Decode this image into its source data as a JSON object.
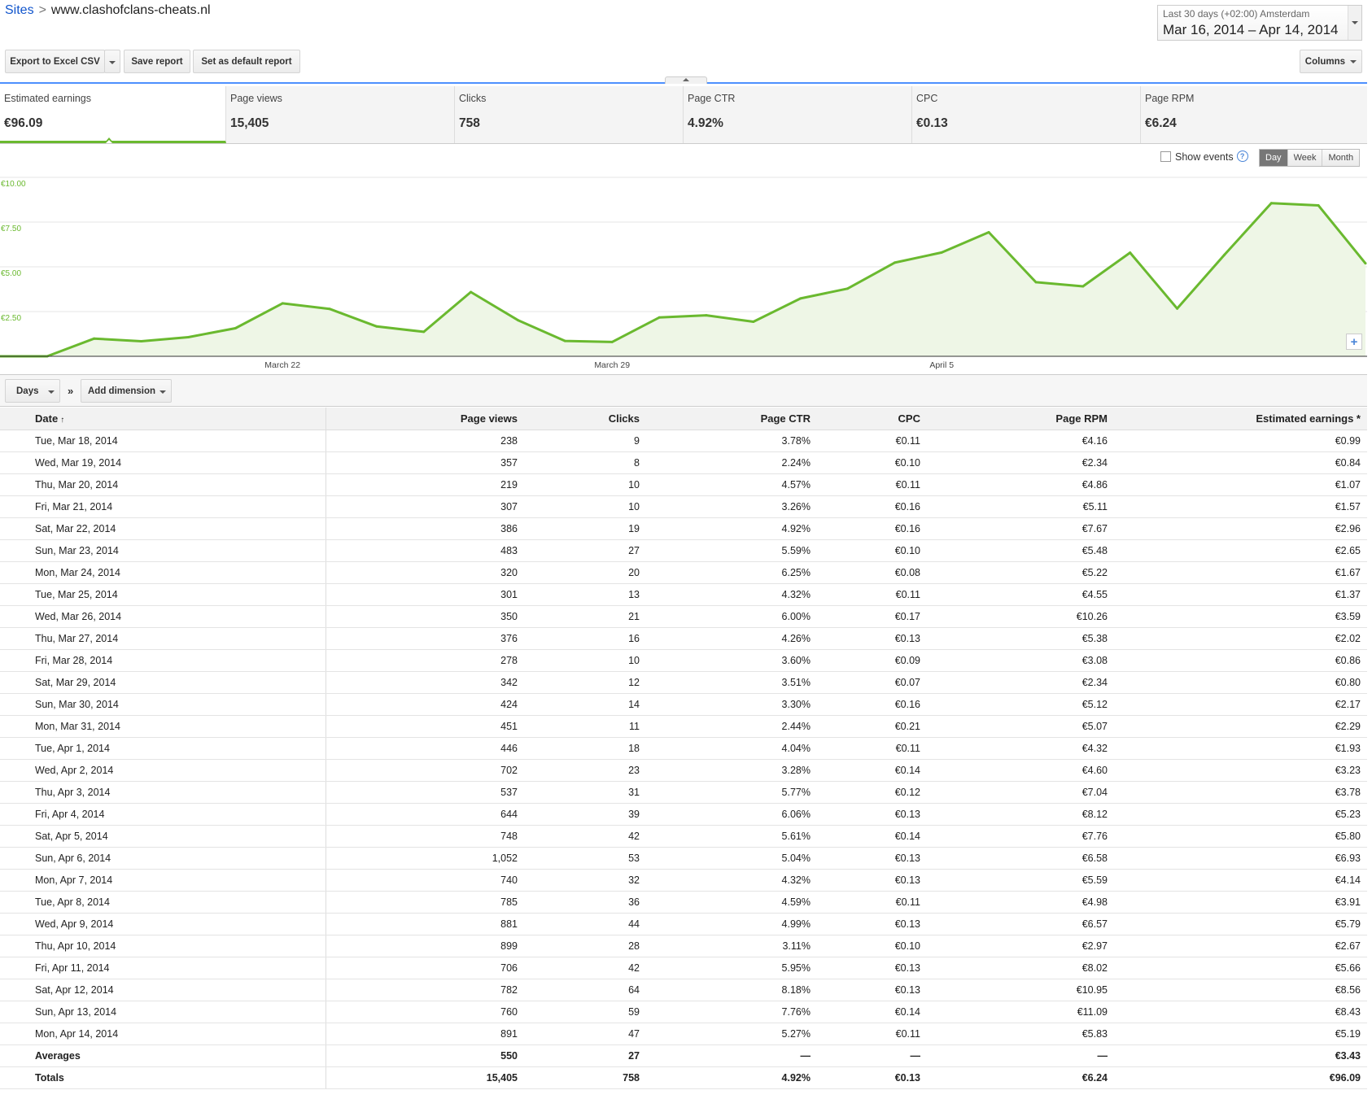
{
  "breadcrumb": {
    "root": "Sites",
    "separator": ">",
    "current": "www.clashofclans-cheats.nl"
  },
  "date_range": {
    "label": "Last 30 days (+02:00) Amsterdam",
    "value": "Mar 16, 2014 – Apr 14, 2014"
  },
  "toolbar": {
    "export_label": "Export to Excel CSV",
    "save_label": "Save report",
    "default_label": "Set as default report",
    "columns_label": "Columns"
  },
  "metrics": [
    {
      "name": "Estimated earnings",
      "value": "€96.09"
    },
    {
      "name": "Page views",
      "value": "15,405"
    },
    {
      "name": "Clicks",
      "value": "758"
    },
    {
      "name": "Page CTR",
      "value": "4.92%"
    },
    {
      "name": "CPC",
      "value": "€0.13"
    },
    {
      "name": "Page RPM",
      "value": "€6.24"
    }
  ],
  "chart_controls": {
    "show_events": "Show events",
    "help": "?",
    "add": "+",
    "granularity": [
      "Day",
      "Week",
      "Month"
    ],
    "selected": "Day"
  },
  "chart_data": {
    "type": "area",
    "x": [
      "Mar 16",
      "Mar 17",
      "Mar 18",
      "Mar 19",
      "Mar 20",
      "Mar 21",
      "Mar 22",
      "Mar 23",
      "Mar 24",
      "Mar 25",
      "Mar 26",
      "Mar 27",
      "Mar 28",
      "Mar 29",
      "Mar 30",
      "Mar 31",
      "Apr 1",
      "Apr 2",
      "Apr 3",
      "Apr 4",
      "Apr 5",
      "Apr 6",
      "Apr 7",
      "Apr 8",
      "Apr 9",
      "Apr 10",
      "Apr 11",
      "Apr 12",
      "Apr 13",
      "Apr 14"
    ],
    "series": [
      {
        "values": [
          0,
          0,
          0.99,
          0.84,
          1.07,
          1.57,
          2.96,
          2.65,
          1.67,
          1.37,
          3.59,
          2.02,
          0.86,
          0.8,
          2.17,
          2.29,
          1.93,
          3.23,
          3.78,
          5.23,
          5.8,
          6.93,
          4.14,
          3.91,
          5.79,
          2.67,
          5.66,
          8.56,
          8.43,
          5.19
        ]
      }
    ],
    "y_ticks": [
      "€10.00",
      "€7.50",
      "€5.00",
      "€2.50"
    ],
    "y_tick_values": [
      10,
      7.5,
      5,
      2.5
    ],
    "x_tick_labels": [
      "March 22",
      "March 29",
      "April 5"
    ],
    "x_tick_dates": [
      "Mar 22",
      "Mar 29",
      "Apr 5"
    ],
    "ylim": [
      0,
      10
    ],
    "grid": true,
    "color": "#6ab92f",
    "fill": "#eef6e6"
  },
  "dimension_bar": {
    "days_label": "Days",
    "chevron": "»",
    "add_label": "Add dimension"
  },
  "table": {
    "headers": [
      "Date",
      "Page views",
      "Clicks",
      "Page CTR",
      "CPC",
      "Page RPM",
      "Estimated earnings *"
    ],
    "sort_indicator": "↑",
    "rows": [
      [
        "Tue, Mar 18, 2014",
        "238",
        "9",
        "3.78%",
        "€0.11",
        "€4.16",
        "€0.99"
      ],
      [
        "Wed, Mar 19, 2014",
        "357",
        "8",
        "2.24%",
        "€0.10",
        "€2.34",
        "€0.84"
      ],
      [
        "Thu, Mar 20, 2014",
        "219",
        "10",
        "4.57%",
        "€0.11",
        "€4.86",
        "€1.07"
      ],
      [
        "Fri, Mar 21, 2014",
        "307",
        "10",
        "3.26%",
        "€0.16",
        "€5.11",
        "€1.57"
      ],
      [
        "Sat, Mar 22, 2014",
        "386",
        "19",
        "4.92%",
        "€0.16",
        "€7.67",
        "€2.96"
      ],
      [
        "Sun, Mar 23, 2014",
        "483",
        "27",
        "5.59%",
        "€0.10",
        "€5.48",
        "€2.65"
      ],
      [
        "Mon, Mar 24, 2014",
        "320",
        "20",
        "6.25%",
        "€0.08",
        "€5.22",
        "€1.67"
      ],
      [
        "Tue, Mar 25, 2014",
        "301",
        "13",
        "4.32%",
        "€0.11",
        "€4.55",
        "€1.37"
      ],
      [
        "Wed, Mar 26, 2014",
        "350",
        "21",
        "6.00%",
        "€0.17",
        "€10.26",
        "€3.59"
      ],
      [
        "Thu, Mar 27, 2014",
        "376",
        "16",
        "4.26%",
        "€0.13",
        "€5.38",
        "€2.02"
      ],
      [
        "Fri, Mar 28, 2014",
        "278",
        "10",
        "3.60%",
        "€0.09",
        "€3.08",
        "€0.86"
      ],
      [
        "Sat, Mar 29, 2014",
        "342",
        "12",
        "3.51%",
        "€0.07",
        "€2.34",
        "€0.80"
      ],
      [
        "Sun, Mar 30, 2014",
        "424",
        "14",
        "3.30%",
        "€0.16",
        "€5.12",
        "€2.17"
      ],
      [
        "Mon, Mar 31, 2014",
        "451",
        "11",
        "2.44%",
        "€0.21",
        "€5.07",
        "€2.29"
      ],
      [
        "Tue, Apr 1, 2014",
        "446",
        "18",
        "4.04%",
        "€0.11",
        "€4.32",
        "€1.93"
      ],
      [
        "Wed, Apr 2, 2014",
        "702",
        "23",
        "3.28%",
        "€0.14",
        "€4.60",
        "€3.23"
      ],
      [
        "Thu, Apr 3, 2014",
        "537",
        "31",
        "5.77%",
        "€0.12",
        "€7.04",
        "€3.78"
      ],
      [
        "Fri, Apr 4, 2014",
        "644",
        "39",
        "6.06%",
        "€0.13",
        "€8.12",
        "€5.23"
      ],
      [
        "Sat, Apr 5, 2014",
        "748",
        "42",
        "5.61%",
        "€0.14",
        "€7.76",
        "€5.80"
      ],
      [
        "Sun, Apr 6, 2014",
        "1,052",
        "53",
        "5.04%",
        "€0.13",
        "€6.58",
        "€6.93"
      ],
      [
        "Mon, Apr 7, 2014",
        "740",
        "32",
        "4.32%",
        "€0.13",
        "€5.59",
        "€4.14"
      ],
      [
        "Tue, Apr 8, 2014",
        "785",
        "36",
        "4.59%",
        "€0.11",
        "€4.98",
        "€3.91"
      ],
      [
        "Wed, Apr 9, 2014",
        "881",
        "44",
        "4.99%",
        "€0.13",
        "€6.57",
        "€5.79"
      ],
      [
        "Thu, Apr 10, 2014",
        "899",
        "28",
        "3.11%",
        "€0.10",
        "€2.97",
        "€2.67"
      ],
      [
        "Fri, Apr 11, 2014",
        "706",
        "42",
        "5.95%",
        "€0.13",
        "€8.02",
        "€5.66"
      ],
      [
        "Sat, Apr 12, 2014",
        "782",
        "64",
        "8.18%",
        "€0.13",
        "€10.95",
        "€8.56"
      ],
      [
        "Sun, Apr 13, 2014",
        "760",
        "59",
        "7.76%",
        "€0.14",
        "€11.09",
        "€8.43"
      ],
      [
        "Mon, Apr 14, 2014",
        "891",
        "47",
        "5.27%",
        "€0.11",
        "€5.83",
        "€5.19"
      ]
    ],
    "averages": [
      "Averages",
      "550",
      "27",
      "—",
      "—",
      "—",
      "€3.43"
    ],
    "totals": [
      "Totals",
      "15,405",
      "758",
      "4.92%",
      "€0.13",
      "€6.24",
      "€96.09"
    ]
  }
}
